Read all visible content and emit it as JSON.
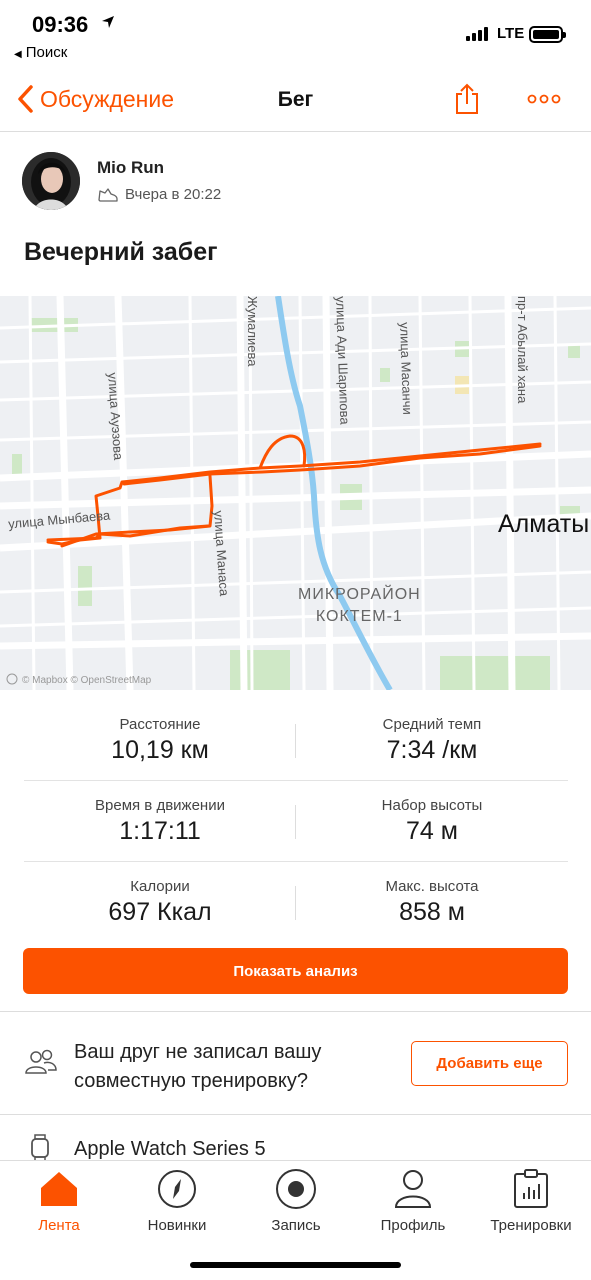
{
  "status_bar": {
    "time": "09:36",
    "back_label": "Поиск",
    "network": "LTE"
  },
  "nav": {
    "back_label": "Обсуждение",
    "title": "Бег",
    "share_icon": "share-icon",
    "more_icon": "more-icon"
  },
  "athlete": {
    "name": "Mio Run",
    "timestamp": "Вчера в 20:22",
    "activity_icon": "shoe-icon"
  },
  "activity": {
    "title": "Вечерний забег"
  },
  "map": {
    "streets": [
      "улица Ауэзова",
      "улица Мынбаева",
      "улица Манаса",
      "Жумалиева",
      "улица Ади Шарипова",
      "улица Масанчи",
      "пр-т Абылай хана"
    ],
    "city": "Алматы",
    "district": [
      "МИКРОРАЙОН",
      "КОКТЕМ-1"
    ],
    "attribution": "© Mapbox © OpenStreetMap",
    "route_color": "#fc5200"
  },
  "stats": [
    {
      "left": {
        "label": "Расстояние",
        "value": "10,19 км"
      },
      "right": {
        "label": "Средний темп",
        "value": "7:34 /км"
      }
    },
    {
      "left": {
        "label": "Время в движении",
        "value": "1:17:11"
      },
      "right": {
        "label": "Набор высоты",
        "value": "74 м"
      }
    },
    {
      "left": {
        "label": "Калории",
        "value": "697 Ккал"
      },
      "right": {
        "label": "Макс. высота",
        "value": "858 м"
      }
    }
  ],
  "analyze_button": "Показать анализ",
  "friend_prompt": {
    "text": "Ваш друг не записал вашу совместную тренировку?",
    "button": "Добавить еще"
  },
  "device": {
    "name": "Apple Watch Series 5"
  },
  "tabs": [
    {
      "label": "Лента",
      "icon": "home-icon",
      "active": true
    },
    {
      "label": "Новинки",
      "icon": "compass-icon",
      "active": false
    },
    {
      "label": "Запись",
      "icon": "record-icon",
      "active": false
    },
    {
      "label": "Профиль",
      "icon": "profile-icon",
      "active": false
    },
    {
      "label": "Тренировки",
      "icon": "training-log-icon",
      "active": false
    }
  ],
  "colors": {
    "accent": "#fc5200"
  }
}
